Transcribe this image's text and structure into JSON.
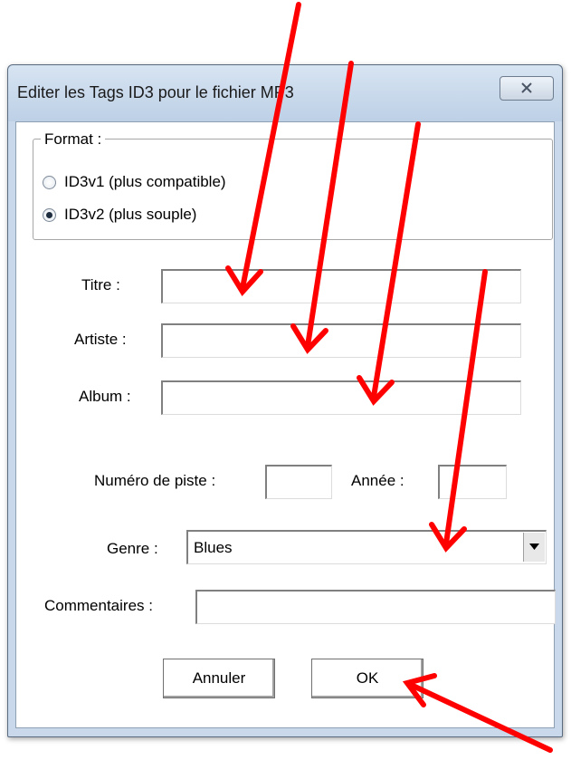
{
  "window": {
    "title": "Editer les Tags ID3 pour le fichier MP3",
    "close_glyph": "⨯"
  },
  "format_group": {
    "legend": "Format :",
    "options": [
      {
        "label": "ID3v1 (plus compatible)",
        "selected": false
      },
      {
        "label": "ID3v2 (plus souple)",
        "selected": true
      }
    ]
  },
  "fields": {
    "title_label": "Titre :",
    "title_value": "",
    "artist_label": "Artiste :",
    "artist_value": "",
    "album_label": "Album :",
    "album_value": "",
    "track_label": "Numéro de piste :",
    "track_value": "",
    "year_label": "Année :",
    "year_value": "",
    "genre_label": "Genre :",
    "genre_value": "Blues",
    "comments_label": "Commentaires :",
    "comments_value": ""
  },
  "buttons": {
    "cancel": "Annuler",
    "ok": "OK"
  },
  "colors": {
    "annotation_arrow": "#ff0000",
    "window_frame": "#c9d8ea"
  }
}
